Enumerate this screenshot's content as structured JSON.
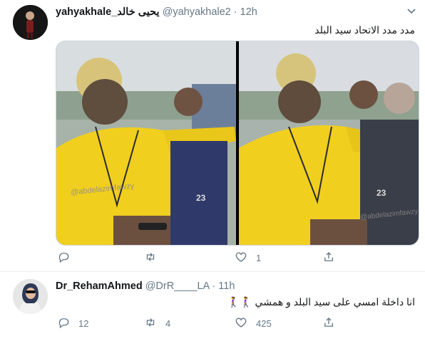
{
  "tweets": [
    {
      "display_name": "yahyakhale_يحيى خالد",
      "handle": "@yahyakhale2",
      "separator": "·",
      "time": "12h",
      "text": "مدد مدد الاتحاد سيد البلد",
      "watermark": "@abdelazimfawzy",
      "jersey_number": "23",
      "reply_count": "",
      "retweet_count": "",
      "like_count": "1"
    },
    {
      "display_name": "Dr_RehamAhmed",
      "handle": "@DrR____LA",
      "separator": "·",
      "time": "11h",
      "text": "انا داخلة امسي على سيد البلد و همشي 🚶‍♀️🚶‍♀️",
      "reply_count": "12",
      "retweet_count": "4",
      "like_count": "425"
    }
  ],
  "icons": {
    "menu": "chevron-down-icon",
    "reply": "reply-icon",
    "retweet": "retweet-icon",
    "like": "heart-icon",
    "share": "share-icon"
  }
}
